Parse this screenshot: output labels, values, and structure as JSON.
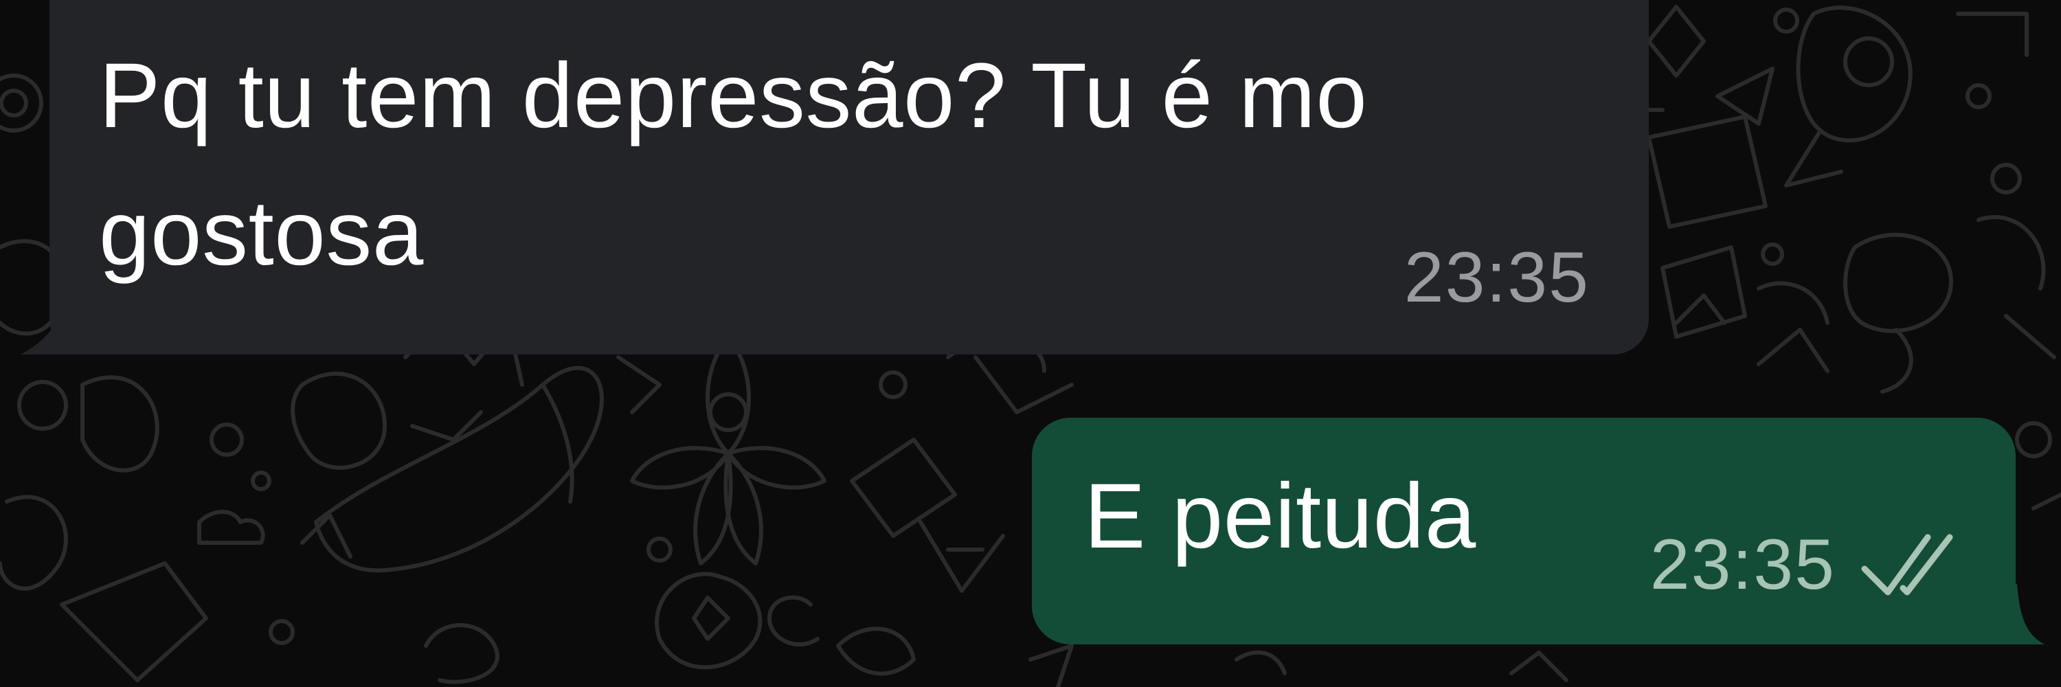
{
  "chat": {
    "messages": [
      {
        "direction": "incoming",
        "text_line1": "Pq tu tem depressão? Tu é mo",
        "text_line2": "gostosa",
        "time": "23:35"
      },
      {
        "direction": "outgoing",
        "text_line1": "E peituda",
        "time": "23:35",
        "status": "read"
      }
    ]
  },
  "icons": {
    "read_status": "double-check-icon"
  },
  "colors": {
    "background": "#0b0b0b",
    "incoming_bubble": "#232427",
    "outgoing_bubble": "#144d37",
    "message_text": "#ffffff",
    "incoming_time": "#9a9ba0",
    "outgoing_time": "#a7c4b5",
    "wallpaper_doodle": "#2b2b2b"
  }
}
